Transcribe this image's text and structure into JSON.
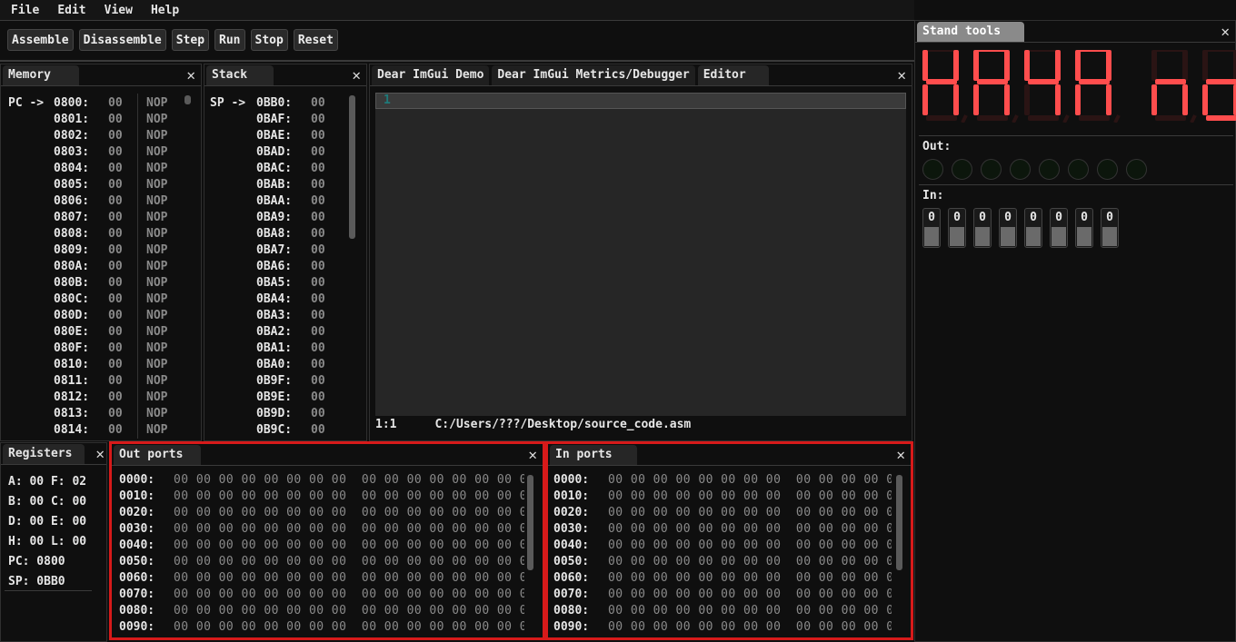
{
  "menu": [
    "File",
    "Edit",
    "View",
    "Help"
  ],
  "toolbar": [
    "Assemble",
    "Disassemble",
    "Step",
    "Run",
    "Stop",
    "Reset"
  ],
  "memory": {
    "title": "Memory",
    "pc_label": "PC ->",
    "rows": [
      [
        "0800:",
        "00",
        "NOP"
      ],
      [
        "0801:",
        "00",
        "NOP"
      ],
      [
        "0802:",
        "00",
        "NOP"
      ],
      [
        "0803:",
        "00",
        "NOP"
      ],
      [
        "0804:",
        "00",
        "NOP"
      ],
      [
        "0805:",
        "00",
        "NOP"
      ],
      [
        "0806:",
        "00",
        "NOP"
      ],
      [
        "0807:",
        "00",
        "NOP"
      ],
      [
        "0808:",
        "00",
        "NOP"
      ],
      [
        "0809:",
        "00",
        "NOP"
      ],
      [
        "080A:",
        "00",
        "NOP"
      ],
      [
        "080B:",
        "00",
        "NOP"
      ],
      [
        "080C:",
        "00",
        "NOP"
      ],
      [
        "080D:",
        "00",
        "NOP"
      ],
      [
        "080E:",
        "00",
        "NOP"
      ],
      [
        "080F:",
        "00",
        "NOP"
      ],
      [
        "0810:",
        "00",
        "NOP"
      ],
      [
        "0811:",
        "00",
        "NOP"
      ],
      [
        "0812:",
        "00",
        "NOP"
      ],
      [
        "0813:",
        "00",
        "NOP"
      ],
      [
        "0814:",
        "00",
        "NOP"
      ]
    ]
  },
  "stack": {
    "title": "Stack",
    "sp_label": "SP ->",
    "rows": [
      [
        "0BB0:",
        "00"
      ],
      [
        "0BAF:",
        "00"
      ],
      [
        "0BAE:",
        "00"
      ],
      [
        "0BAD:",
        "00"
      ],
      [
        "0BAC:",
        "00"
      ],
      [
        "0BAB:",
        "00"
      ],
      [
        "0BAA:",
        "00"
      ],
      [
        "0BA9:",
        "00"
      ],
      [
        "0BA8:",
        "00"
      ],
      [
        "0BA7:",
        "00"
      ],
      [
        "0BA6:",
        "00"
      ],
      [
        "0BA5:",
        "00"
      ],
      [
        "0BA4:",
        "00"
      ],
      [
        "0BA3:",
        "00"
      ],
      [
        "0BA2:",
        "00"
      ],
      [
        "0BA1:",
        "00"
      ],
      [
        "0BA0:",
        "00"
      ],
      [
        "0B9F:",
        "00"
      ],
      [
        "0B9E:",
        "00"
      ],
      [
        "0B9D:",
        "00"
      ],
      [
        "0B9C:",
        "00"
      ]
    ]
  },
  "editor": {
    "tabs": [
      "Dear ImGui Demo",
      "Dear ImGui Metrics/Debugger",
      "Editor"
    ],
    "line_number": "1",
    "cursor": "1:1",
    "path": "C:/Users/???/Desktop/source_code.asm"
  },
  "registers": {
    "title": "Registers",
    "lines": [
      "A: 00 F: 02",
      "B: 00 C: 00",
      "D: 00 E: 00",
      "H: 00 L: 00",
      "PC: 0800",
      "SP: 0BB0"
    ]
  },
  "out_ports": {
    "title": "Out ports",
    "addresses": [
      "0000:",
      "0010:",
      "0020:",
      "0030:",
      "0040:",
      "0050:",
      "0060:",
      "0070:",
      "0080:",
      "0090:"
    ],
    "bytes": "00 00 00 00 00 00 00 00  00 00 00 00 00 00 00 0"
  },
  "in_ports": {
    "title": "In ports",
    "addresses": [
      "0000:",
      "0010:",
      "0020:",
      "0030:",
      "0040:",
      "0050:",
      "0060:",
      "0070:",
      "0080:",
      "0090:"
    ],
    "bytes": "00 00 00 00 00 00 00 00  00 00 00 00 00 00 00 0"
  },
  "stand": {
    "title": "Stand tools",
    "segments": [
      "bcefg",
      "abcefg",
      "bcfg",
      "abcefg",
      "ceg",
      "cdeg"
    ],
    "seg_on": "#ff4d4d",
    "seg_off": "#2a1414",
    "out_label": "Out:",
    "leds": [
      0,
      0,
      0,
      0,
      0,
      0,
      0,
      0
    ],
    "in_label": "In:",
    "switches": [
      "0",
      "0",
      "0",
      "0",
      "0",
      "0",
      "0",
      "0"
    ]
  }
}
